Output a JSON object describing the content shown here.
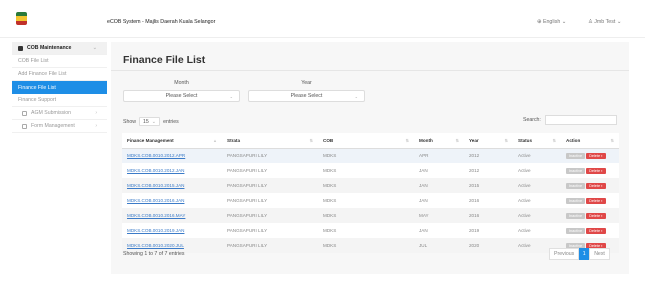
{
  "header": {
    "app_title": "eCOB System - Majlis Daerah Kuala Selangor",
    "language": "English",
    "user": "Jmb Test"
  },
  "sidebar": {
    "items": [
      {
        "label": "COB Maintenance",
        "type": "header"
      },
      {
        "label": "COB File List",
        "type": "sub"
      },
      {
        "label": "Add Finance File List",
        "type": "sub"
      },
      {
        "label": "Finance File List",
        "type": "active"
      },
      {
        "label": "Finance Support",
        "type": "sub"
      },
      {
        "label": "AGM Submission",
        "type": "group"
      },
      {
        "label": "Form Management",
        "type": "group"
      }
    ]
  },
  "main": {
    "title": "Finance File List",
    "filters": {
      "month_label": "Month",
      "month_value": "Please Select",
      "year_label": "Year",
      "year_value": "Please Select"
    },
    "show_prefix": "Show",
    "show_value": "15",
    "show_suffix": "entries",
    "search_label": "Search:",
    "columns": [
      "Finance Management",
      "Strata",
      "COB",
      "Month",
      "Year",
      "Status",
      "Action"
    ],
    "rows": [
      {
        "finance": "MDKS.COB.0010.2012.APR",
        "strata": "PANGSAPURI LILY",
        "cob": "MDKS",
        "month": "APR",
        "year": "2012",
        "status": "Active"
      },
      {
        "finance": "MDKS.COB.0010.2012.JAN",
        "strata": "PANGSAPURI LILY",
        "cob": "MDKS",
        "month": "JAN",
        "year": "2012",
        "status": "Active"
      },
      {
        "finance": "MDKS.COB.0010.2015.JAN",
        "strata": "PANGSAPURI LILY",
        "cob": "MDKS",
        "month": "JAN",
        "year": "2015",
        "status": "Active"
      },
      {
        "finance": "MDKS.COB.0010.2016.JAN",
        "strata": "PANGSAPURI LILY",
        "cob": "MDKS",
        "month": "JAN",
        "year": "2016",
        "status": "Active"
      },
      {
        "finance": "MDKS.COB.0010.2016.MAY",
        "strata": "PANGSAPURI LILY",
        "cob": "MDKS",
        "month": "MAY",
        "year": "2016",
        "status": "Active"
      },
      {
        "finance": "MDKS.COB.0010.2019.JAN",
        "strata": "PANGSAPURI LILY",
        "cob": "MDKS",
        "month": "JAN",
        "year": "2019",
        "status": "Active"
      },
      {
        "finance": "MDKS.COB.0010.2020.JUL",
        "strata": "PANGSAPURI LILY",
        "cob": "MDKS",
        "month": "JUL",
        "year": "2020",
        "status": "Active"
      }
    ],
    "inactive_label": "Inactive",
    "delete_label": "Delete",
    "info": "Showing 1 to 7 of 7 entries",
    "pagination": {
      "previous": "Previous",
      "current": "1",
      "next": "Next"
    }
  },
  "colors": {
    "accent": "#1e8ee6",
    "delete": "#e04848",
    "link": "#3b7bc8"
  },
  "icons": {
    "language": "globe-icon",
    "user": "user-icon",
    "cob": "folder-icon",
    "agm": "bank-icon",
    "form": "file-icon",
    "delete": "trash-icon"
  }
}
